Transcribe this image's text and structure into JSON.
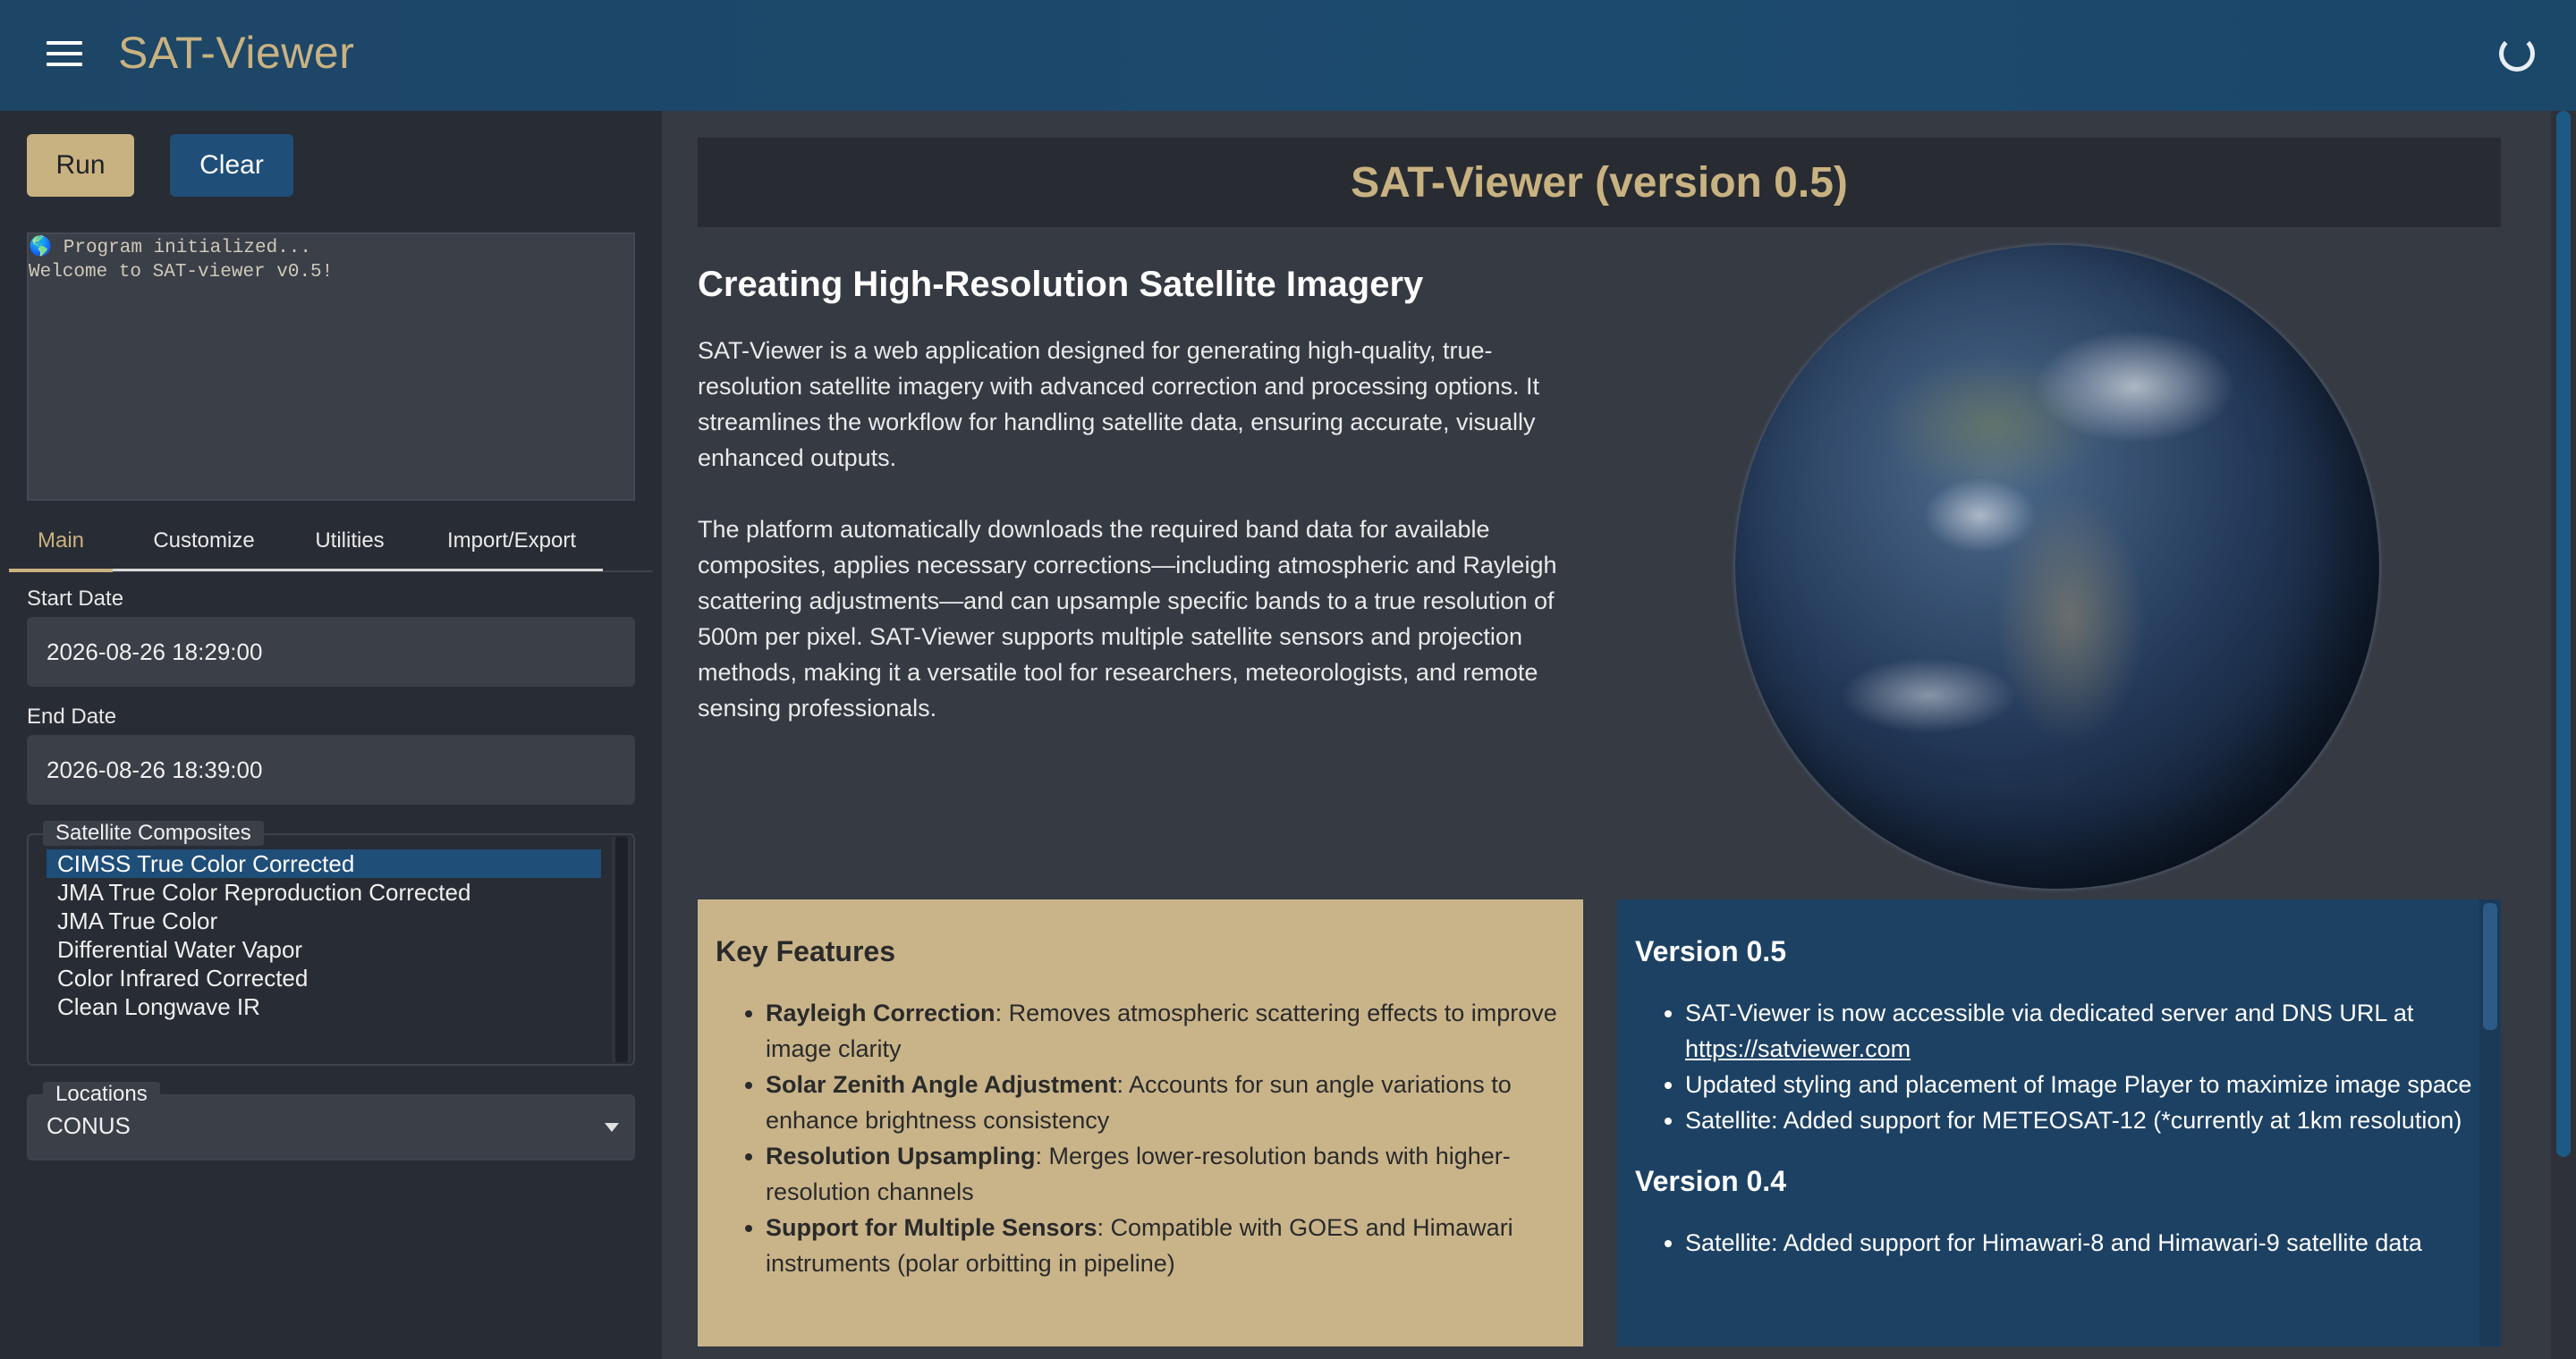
{
  "header": {
    "title": "SAT-Viewer",
    "menu_icon": "hamburger-menu-icon",
    "status_icon": "loading-spinner-icon"
  },
  "controls": {
    "run_label": "Run",
    "clear_label": "Clear"
  },
  "console": {
    "lines": [
      "🌎 Program initialized...",
      "Welcome to SAT-viewer v0.5!"
    ]
  },
  "tabs": [
    {
      "label": "Main",
      "active": true
    },
    {
      "label": "Customize",
      "active": false
    },
    {
      "label": "Utilities",
      "active": false
    },
    {
      "label": "Import/Export",
      "active": false
    }
  ],
  "form": {
    "start_date_label": "Start Date",
    "start_date_value": "2026-08-26 18:29:00",
    "end_date_label": "End Date",
    "end_date_value": "2026-08-26 18:39:00",
    "composites_label": "Satellite Composites",
    "composites": [
      "CIMSS True Color Corrected",
      "JMA True Color Reproduction Corrected",
      "JMA True Color",
      "Differential Water Vapor",
      "Color Infrared Corrected",
      "Clean Longwave IR"
    ],
    "composites_selected": "CIMSS True Color Corrected",
    "locations_label": "Locations",
    "locations_value": "CONUS"
  },
  "main": {
    "title": "SAT-Viewer (version 0.5)",
    "intro_heading": "Creating High-Resolution Satellite Imagery",
    "intro_paragraphs": [
      "SAT-Viewer is a web application designed for generating high-quality, true-resolution satellite imagery with advanced correction and processing options. It streamlines the workflow for handling satellite data, ensuring accurate, visually enhanced outputs.",
      "The platform automatically downloads the required band data for available composites, applies necessary corrections—including atmospheric and Rayleigh scattering adjustments—and can upsample specific bands to a true resolution of 500m per pixel. SAT-Viewer supports multiple satellite sensors and projection methods, making it a versatile tool for researchers, meteorologists, and remote sensing professionals."
    ],
    "features": {
      "heading": "Key Features",
      "items": [
        {
          "name": "Rayleigh Correction",
          "desc": ": Removes atmospheric scattering effects to improve image clarity"
        },
        {
          "name": "Solar Zenith Angle Adjustment",
          "desc": ": Accounts for sun angle variations to enhance brightness consistency"
        },
        {
          "name": "Resolution Upsampling",
          "desc": ": Merges lower-resolution bands with higher-resolution channels"
        },
        {
          "name": "Support for Multiple Sensors",
          "desc": ": Compatible with GOES and Himawari instruments (polar orbitting in pipeline)"
        }
      ]
    },
    "versions": {
      "v05_heading": "Version 0.5",
      "v05_items": [
        {
          "text": "SAT-Viewer is now accessible via dedicated server and DNS URL at ",
          "link": "https://satviewer.com"
        },
        {
          "text": "Updated styling and placement of Image Player to maximize image space",
          "link": ""
        },
        {
          "text": "Satellite: Added support for METEOSAT-12 (*currently at 1km resolution)",
          "link": ""
        }
      ],
      "v04_heading": "Version 0.4",
      "v04_items": [
        {
          "text": "Satellite: Added support for Himawari-8 and Himawari-9 satellite data",
          "link": ""
        }
      ]
    }
  }
}
